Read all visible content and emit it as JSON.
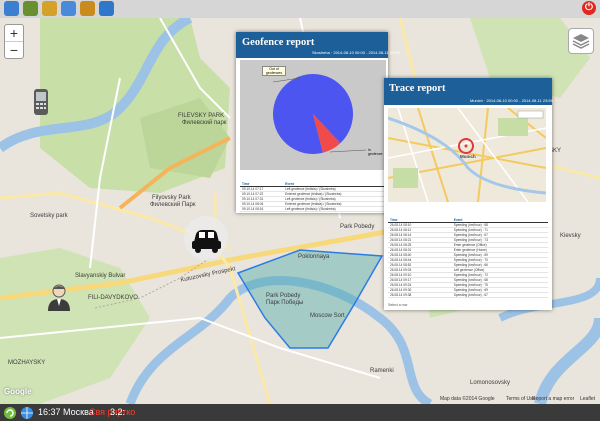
{
  "toolbar": {
    "buttons": [
      {
        "name": "home-icon",
        "color": "#3b7fd0"
      },
      {
        "name": "users-icon",
        "color": "#6a8f2e"
      },
      {
        "name": "route-icon",
        "color": "#d4a12a"
      },
      {
        "name": "document-icon",
        "color": "#4a8ad8"
      },
      {
        "name": "settings-icon",
        "color": "#c98b1e"
      },
      {
        "name": "help-icon",
        "color": "#2f77c9"
      }
    ],
    "power_glyph": "⏻"
  },
  "map": {
    "zoom_in": "+",
    "zoom_out": "−",
    "labels": {
      "filevsky_park": "FILEVSKY PARK",
      "filyovsky_park_ru": "Филевский парк",
      "filyovsky_park": "Filyovsky Park",
      "filyovsky_park_ru2": "Филевский Парк",
      "poklonnaya": "Poklonnaya",
      "park_pobedy": "Park Pobedy",
      "park_pobedy_ru": "Парк Победы",
      "park_pobedy_station": "Park Pobedy",
      "moscow_sort": "Moscow Sort",
      "kutuzovsky": "Kutuzovsky Prospekt",
      "slavyansky": "Slavyanskiy Bulvar",
      "fili_davydkovo": "FILI-DAVYDKOVO",
      "mozhayskiy": "MOZHAYSKY",
      "sovetsky_park": "Sovetsky park",
      "ramenki": "Ramenki",
      "presnensky": "PRESNENSKY",
      "kievsky": "Kievsky",
      "lomonosovsky": "Lomonosovsky"
    },
    "google_mark": "Google",
    "attribution": "Map data ©2014 Google",
    "terms": "Terms of Use",
    "report_error": "Report a map error",
    "leaflet": "Leaflet"
  },
  "geofence": {
    "title": "Geofence report",
    "header_info": "Skosheba · 2014-08-10 00:00 - 2014-08-11 23:59",
    "pie_label_out": "Out of geofences",
    "pie_label_in": "In geofence",
    "table_headers": [
      "Time",
      "Event"
    ],
    "rows": [
      [
        "09.10.14 07:17",
        "Left geofence (fedisia) / (Skosheba)"
      ],
      [
        "09.10.14 07:22",
        "Entered geofence (fedisia) / (Skosheba)"
      ],
      [
        "09.10.14 07:31",
        "Left geofence (fedisia) / (Skosheba)"
      ],
      [
        "09.10.14 08:04",
        "Entered geofence (fedisia) / (Skosheba)"
      ],
      [
        "09.10.14 08:16",
        "Left geofence (fedisia) / (Skosheba)"
      ]
    ]
  },
  "chart_data": {
    "type": "pie",
    "title": "",
    "labels": [
      "Out of geofences",
      "In geofence"
    ],
    "values": [
      92,
      8
    ],
    "colors": [
      "#4d55f0",
      "#f04a4a"
    ]
  },
  "trace": {
    "title": "Trace report",
    "header_info": "Munich · 2014-08-10 00:00 - 2014-08-11 23:59",
    "map_label": "Munich",
    "table_headers": [
      "Time",
      "Event"
    ],
    "rows": [
      [
        "26.08.14 08:10",
        "Speeding (km/hour) : 68"
      ],
      [
        "26.08.14 08:12",
        "Speeding (km/hour) : 71"
      ],
      [
        "26.08.14 08:14",
        "Speeding (km/hour) : 67"
      ],
      [
        "26.08.14 08:21",
        "Speeding (km/hour) : 73"
      ],
      [
        "26.08.14 08:25",
        "Enter geofence (Office)"
      ],
      [
        "26.08.14 08:31",
        "Enter geofence (Home)"
      ],
      [
        "26.08.14 08:40",
        "Speeding (km/hour) : 69"
      ],
      [
        "26.08.14 08:44",
        "Speeding (km/hour) : 70"
      ],
      [
        "26.08.14 08:52",
        "Speeding (km/hour) : 66"
      ],
      [
        "26.08.14 09:03",
        "Left geofence (Office)"
      ],
      [
        "26.08.14 09:10",
        "Speeding (km/hour) : 72"
      ],
      [
        "26.08.14 09:17",
        "Speeding (km/hour) : 68"
      ],
      [
        "26.08.14 09:24",
        "Speeding (km/hour) : 75"
      ],
      [
        "26.08.14 09:30",
        "Speeding (km/hour) : 69"
      ],
      [
        "26.08.14 09:38",
        "Speeding (km/hour) : 67"
      ]
    ],
    "footer": "Select a row"
  },
  "status": {
    "time_city": "16:37 Москва",
    "alert": "Свя ряртко",
    "suffix": "3.2:"
  }
}
